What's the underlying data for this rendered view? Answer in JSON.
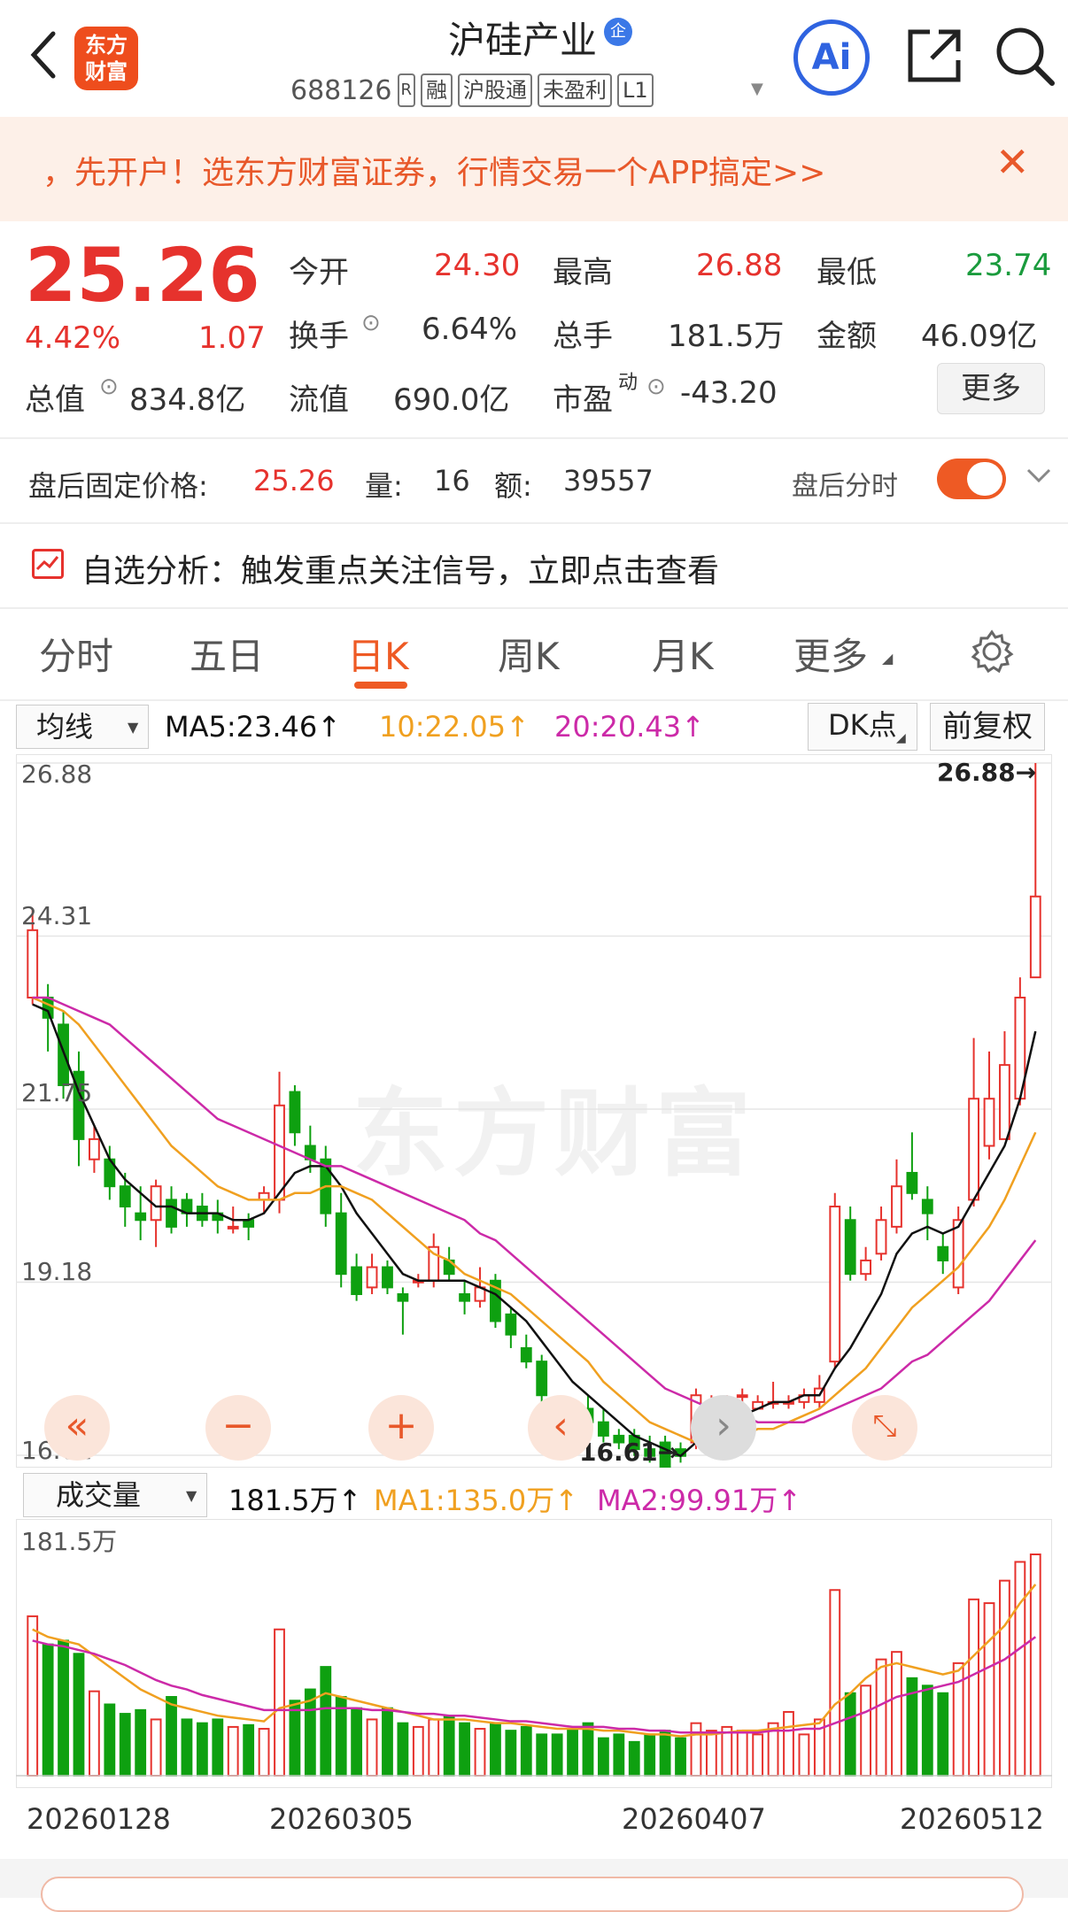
{
  "header": {
    "title": "沪硅产业",
    "badge": "企",
    "code": "688126",
    "code_tags": [
      "融",
      "沪股通",
      "未盈利",
      "L1"
    ],
    "code_sup": "R",
    "ai_label": "Ai"
  },
  "banner": {
    "text": "，先开户！选东方财富证券，行情交易一个APP搞定>>",
    "close": "✕"
  },
  "quote": {
    "price": "25.26",
    "change_pct": "4.42%",
    "change": "1.07",
    "open_label": "今开",
    "open": "24.30",
    "high_label": "最高",
    "high": "26.88",
    "low_label": "最低",
    "low": "23.74",
    "turnover_label": "换手",
    "turnover": "6.64%",
    "volume_label": "总手",
    "volume": "181.5万",
    "amount_label": "金额",
    "amount": "46.09亿",
    "mcap_label": "总值",
    "mcap": "834.8亿",
    "float_label": "流值",
    "float": "690.0亿",
    "pe_label": "市盈",
    "pe_sup": "动",
    "pe": "-43.20",
    "more": "更多"
  },
  "after_hours": {
    "label": "盘后固定价格:",
    "price": "25.26",
    "vol_label": "量:",
    "vol": "16",
    "amt_label": "额:",
    "amt": "39557",
    "toggle_label": "盘后分时"
  },
  "analysis": {
    "text": "自选分析：触发重点关注信号，立即点击查看"
  },
  "tabs": [
    "分时",
    "五日",
    "日K",
    "周K",
    "月K",
    "更多"
  ],
  "active_tab": 2,
  "ma": {
    "select": "均线",
    "ma5": "MA5:23.46↑",
    "ma10": "10:22.05↑",
    "ma20": "20:20.43↑",
    "dk": "DK点",
    "fuquan": "前复权"
  },
  "kchart": {
    "y_labels": [
      "26.88",
      "24.31",
      "21.75",
      "19.18",
      "16.61"
    ],
    "max_label": "26.88→",
    "min_label": "16.61→",
    "watermark": "东方财富"
  },
  "vol": {
    "select": "成交量",
    "value": "181.5万↑",
    "ma1": "MA1:135.0万↑",
    "ma2": "MA2:99.91万↑",
    "max_label": "181.5万"
  },
  "dates": [
    "20260128",
    "20260305",
    "20260407",
    "20260512"
  ],
  "colors": {
    "up": "#e6322d",
    "down": "#0ea010",
    "ma5": "#111111",
    "ma10": "#f0a020",
    "ma20": "#cc2aa8",
    "accent": "#ee5a24"
  },
  "chart_data": {
    "type": "candlestick",
    "ylim": [
      16.61,
      26.88
    ],
    "candles": [
      [
        23.4,
        24.4,
        24.7,
        23.3
      ],
      [
        23.4,
        23.1,
        23.6,
        22.6
      ],
      [
        23.0,
        22.1,
        23.2,
        21.9
      ],
      [
        22.3,
        21.3,
        22.6,
        20.9
      ],
      [
        21.0,
        21.3,
        21.5,
        20.8
      ],
      [
        21.0,
        20.6,
        21.2,
        20.4
      ],
      [
        20.6,
        20.3,
        20.8,
        20.0
      ],
      [
        20.2,
        20.1,
        20.6,
        19.8
      ],
      [
        20.1,
        20.6,
        20.7,
        19.7
      ],
      [
        20.4,
        20.0,
        20.6,
        19.9
      ],
      [
        20.4,
        20.2,
        20.5,
        20.0
      ],
      [
        20.3,
        20.1,
        20.5,
        20.0
      ],
      [
        20.2,
        20.1,
        20.4,
        19.9
      ],
      [
        20.0,
        20.0,
        20.3,
        19.9
      ],
      [
        20.1,
        20.0,
        20.2,
        19.8
      ],
      [
        20.4,
        20.5,
        20.6,
        20.2
      ],
      [
        20.4,
        21.8,
        22.3,
        20.2
      ],
      [
        22.0,
        21.4,
        22.1,
        21.2
      ],
      [
        21.2,
        21.0,
        21.5,
        20.8
      ],
      [
        21.0,
        20.2,
        21.2,
        20.0
      ],
      [
        20.2,
        19.3,
        20.5,
        19.1
      ],
      [
        19.4,
        19.0,
        19.6,
        18.9
      ],
      [
        19.1,
        19.4,
        19.6,
        19.0
      ],
      [
        19.4,
        19.1,
        19.5,
        19.0
      ],
      [
        19.0,
        18.9,
        19.1,
        18.4
      ],
      [
        19.2,
        19.2,
        19.3,
        19.1
      ],
      [
        19.2,
        19.7,
        19.9,
        19.1
      ],
      [
        19.5,
        19.3,
        19.7,
        19.2
      ],
      [
        19.0,
        18.9,
        19.2,
        18.7
      ],
      [
        18.9,
        19.1,
        19.4,
        18.8
      ],
      [
        19.2,
        18.6,
        19.3,
        18.5
      ],
      [
        18.7,
        18.4,
        18.8,
        18.2
      ],
      [
        18.2,
        18.0,
        18.4,
        17.9
      ],
      [
        18.0,
        17.5,
        18.1,
        17.4
      ],
      [
        17.2,
        16.8,
        17.3,
        16.7
      ],
      [
        17.2,
        17.1,
        17.4,
        16.9
      ],
      [
        17.3,
        17.1,
        17.5,
        17.0
      ],
      [
        17.1,
        16.9,
        17.3,
        16.8
      ],
      [
        16.9,
        16.8,
        17.0,
        16.7
      ],
      [
        16.9,
        16.7,
        17.0,
        16.6
      ],
      [
        16.7,
        16.6,
        16.9,
        16.5
      ],
      [
        16.8,
        16.4,
        16.9,
        16.3
      ],
      [
        16.7,
        16.6,
        16.8,
        16.5
      ],
      [
        16.8,
        17.5,
        17.6,
        16.7
      ],
      [
        17.2,
        17.3,
        17.5,
        17.1
      ],
      [
        17.2,
        17.4,
        17.5,
        17.1
      ],
      [
        17.5,
        17.5,
        17.6,
        17.3
      ],
      [
        17.3,
        17.4,
        17.5,
        17.3
      ],
      [
        17.4,
        17.4,
        17.7,
        17.3
      ],
      [
        17.4,
        17.4,
        17.5,
        17.3
      ],
      [
        17.4,
        17.5,
        17.6,
        17.3
      ],
      [
        17.4,
        17.6,
        17.8,
        17.3
      ],
      [
        18.0,
        20.3,
        20.5,
        17.9
      ],
      [
        20.1,
        19.3,
        20.3,
        19.2
      ],
      [
        19.3,
        19.5,
        19.7,
        19.2
      ],
      [
        19.6,
        20.1,
        20.3,
        19.5
      ],
      [
        20.0,
        20.6,
        21.0,
        19.9
      ],
      [
        20.8,
        20.5,
        21.4,
        20.4
      ],
      [
        20.4,
        20.2,
        20.6,
        19.8
      ],
      [
        19.7,
        19.5,
        19.9,
        19.3
      ],
      [
        19.1,
        20.1,
        20.3,
        19.0
      ],
      [
        20.4,
        21.9,
        22.8,
        20.3
      ],
      [
        21.2,
        21.9,
        22.6,
        21.0
      ],
      [
        21.3,
        22.4,
        22.9,
        21.3
      ],
      [
        21.9,
        23.4,
        23.7,
        21.8
      ],
      [
        23.7,
        24.9,
        26.88,
        23.7
      ]
    ],
    "ma5": [
      23.3,
      23.2,
      22.6,
      22.0,
      21.5,
      21.0,
      20.7,
      20.5,
      20.3,
      20.3,
      20.2,
      20.2,
      20.2,
      20.1,
      20.1,
      20.2,
      20.5,
      20.8,
      20.9,
      20.9,
      20.6,
      20.2,
      19.9,
      19.6,
      19.3,
      19.2,
      19.2,
      19.2,
      19.2,
      19.1,
      19.0,
      18.8,
      18.6,
      18.3,
      18.0,
      17.7,
      17.5,
      17.3,
      17.1,
      16.9,
      16.8,
      16.7,
      16.6,
      16.8,
      16.9,
      17.0,
      17.2,
      17.3,
      17.4,
      17.4,
      17.5,
      17.5,
      17.9,
      18.2,
      18.6,
      19.0,
      19.6,
      19.9,
      20.0,
      19.9,
      20.0,
      20.4,
      20.8,
      21.2,
      21.9,
      22.9
    ],
    "ma10": [
      23.4,
      23.3,
      23.2,
      23.0,
      22.7,
      22.4,
      22.1,
      21.8,
      21.5,
      21.2,
      21.0,
      20.8,
      20.6,
      20.5,
      20.4,
      20.4,
      20.4,
      20.5,
      20.5,
      20.6,
      20.6,
      20.5,
      20.4,
      20.2,
      20.0,
      19.8,
      19.6,
      19.5,
      19.3,
      19.2,
      19.1,
      19.0,
      18.8,
      18.6,
      18.4,
      18.2,
      18.0,
      17.7,
      17.5,
      17.3,
      17.1,
      17.0,
      16.9,
      16.8,
      16.8,
      16.8,
      16.9,
      17.0,
      17.0,
      17.1,
      17.2,
      17.3,
      17.5,
      17.7,
      17.9,
      18.2,
      18.5,
      18.8,
      19.0,
      19.2,
      19.4,
      19.7,
      20.0,
      20.4,
      20.9,
      21.4
    ],
    "ma20": [
      23.4,
      23.4,
      23.3,
      23.2,
      23.1,
      23.0,
      22.8,
      22.6,
      22.4,
      22.2,
      22.0,
      21.8,
      21.6,
      21.5,
      21.4,
      21.3,
      21.2,
      21.1,
      21.0,
      20.9,
      20.9,
      20.8,
      20.7,
      20.6,
      20.5,
      20.4,
      20.3,
      20.2,
      20.1,
      19.9,
      19.8,
      19.6,
      19.4,
      19.2,
      19.0,
      18.8,
      18.6,
      18.4,
      18.2,
      18.0,
      17.8,
      17.6,
      17.5,
      17.4,
      17.3,
      17.2,
      17.2,
      17.1,
      17.1,
      17.1,
      17.1,
      17.2,
      17.3,
      17.4,
      17.5,
      17.6,
      17.8,
      18.0,
      18.1,
      18.3,
      18.5,
      18.7,
      18.9,
      19.2,
      19.5,
      19.8
    ],
    "volume": [
      85,
      70,
      72,
      65,
      45,
      38,
      33,
      35,
      30,
      42,
      30,
      28,
      30,
      26,
      27,
      25,
      78,
      40,
      46,
      58,
      42,
      36,
      30,
      36,
      28,
      26,
      30,
      32,
      28,
      25,
      28,
      24,
      26,
      22,
      22,
      25,
      28,
      20,
      22,
      18,
      22,
      24,
      20,
      28,
      24,
      26,
      24,
      22,
      28,
      34,
      22,
      30,
      99,
      44,
      48,
      62,
      66,
      52,
      48,
      44,
      60,
      94,
      92,
      104,
      114,
      118
    ],
    "vol_ma1": [
      78,
      74,
      72,
      70,
      64,
      58,
      52,
      46,
      42,
      38,
      36,
      34,
      32,
      31,
      30,
      29,
      36,
      38,
      40,
      44,
      42,
      40,
      38,
      36,
      34,
      32,
      30,
      30,
      30,
      29,
      28,
      28,
      27,
      26,
      25,
      25,
      25,
      24,
      24,
      23,
      22,
      22,
      21,
      22,
      22,
      23,
      24,
      24,
      25,
      26,
      27,
      28,
      38,
      44,
      52,
      58,
      60,
      58,
      56,
      54,
      56,
      64,
      72,
      80,
      92,
      102
    ],
    "vol_ma2": [
      72,
      70,
      69,
      67,
      65,
      62,
      59,
      55,
      51,
      48,
      46,
      43,
      41,
      39,
      37,
      35,
      35,
      35,
      35,
      36,
      36,
      36,
      35,
      35,
      34,
      33,
      33,
      32,
      32,
      31,
      30,
      29,
      29,
      28,
      27,
      26,
      26,
      26,
      25,
      25,
      24,
      24,
      23,
      23,
      23,
      23,
      23,
      23,
      24,
      24,
      25,
      25,
      28,
      31,
      34,
      38,
      42,
      44,
      46,
      48,
      50,
      54,
      58,
      62,
      68,
      74
    ],
    "vol_max": 118,
    "x_dates": [
      "20260128",
      "20260305",
      "20260407",
      "20260512"
    ]
  }
}
